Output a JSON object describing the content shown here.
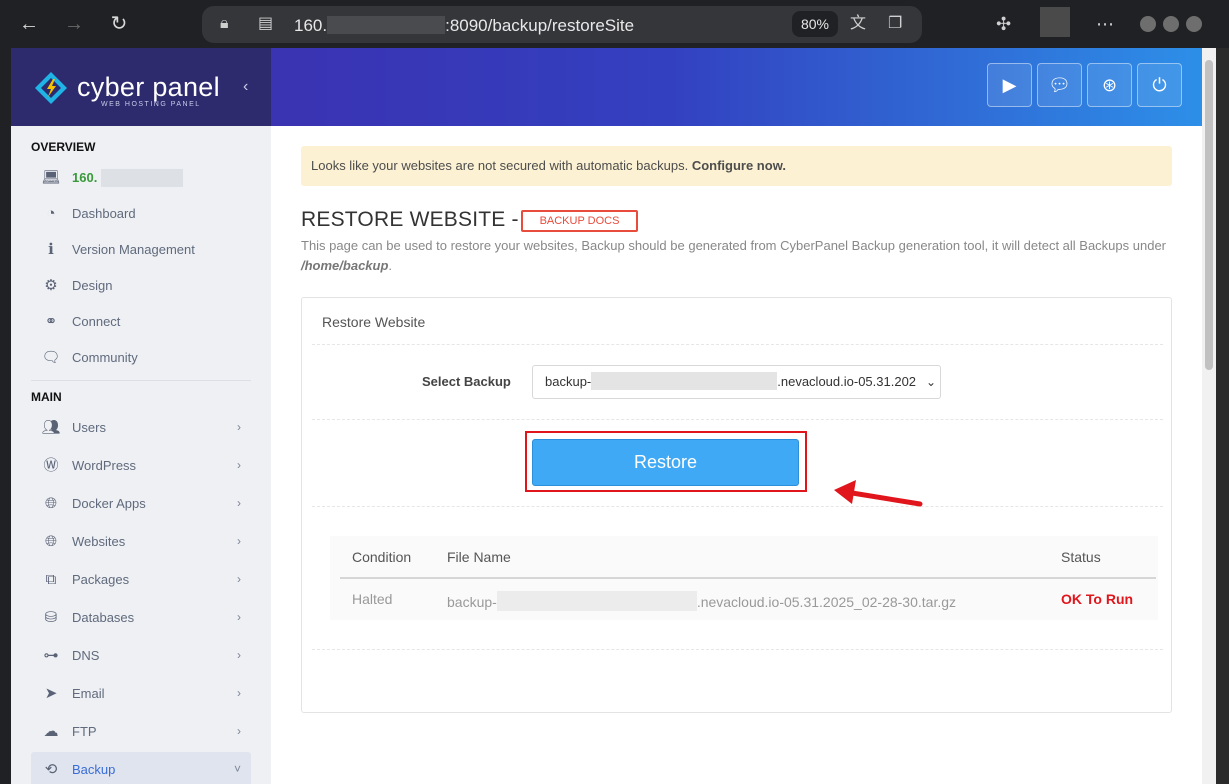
{
  "browser": {
    "url_prefix": "160.",
    "url_suffix": ":8090/backup/restoreSite",
    "zoom": "80%"
  },
  "brand": {
    "name": "cyber panel",
    "subtitle": "WEB HOSTING PANEL"
  },
  "topbar": {
    "buttons": [
      "youtube-icon",
      "chat-icon",
      "support-icon",
      "power-icon"
    ]
  },
  "sidebar": {
    "overview_heading": "OVERVIEW",
    "server_label": "160.",
    "overview_items": [
      {
        "label": "Dashboard",
        "icon": "dashboard-icon"
      },
      {
        "label": "Version Management",
        "icon": "info-icon"
      },
      {
        "label": "Design",
        "icon": "gear-icon"
      },
      {
        "label": "Connect",
        "icon": "link-icon"
      },
      {
        "label": "Community",
        "icon": "comments-icon"
      }
    ],
    "main_heading": "MAIN",
    "main_items": [
      {
        "label": "Users",
        "icon": "users-icon"
      },
      {
        "label": "WordPress",
        "icon": "wordpress-icon"
      },
      {
        "label": "Docker Apps",
        "icon": "globe-icon"
      },
      {
        "label": "Websites",
        "icon": "globe-icon"
      },
      {
        "label": "Packages",
        "icon": "cubes-icon"
      },
      {
        "label": "Databases",
        "icon": "database-icon"
      },
      {
        "label": "DNS",
        "icon": "sitemap-icon"
      },
      {
        "label": "Email",
        "icon": "paper-plane-icon"
      },
      {
        "label": "FTP",
        "icon": "cloud-upload-icon"
      },
      {
        "label": "Backup",
        "icon": "backup-icon"
      }
    ]
  },
  "alert": {
    "text": "Looks like your websites are not secured with automatic backups. ",
    "link": "Configure now."
  },
  "page": {
    "title": "RESTORE WEBSITE -",
    "docs_badge": "BACKUP DOCS",
    "description": "This page can be used to restore your websites, Backup should be generated from CyberPanel Backup generation tool, it will detect all Backups under ",
    "description_path": "/home/backup",
    "description_end": "."
  },
  "card": {
    "title": "Restore Website",
    "select_label": "Select Backup",
    "select_prefix": "backup-",
    "select_suffix": ".nevacloud.io-05.31.202",
    "restore_button": "Restore",
    "table": {
      "headers": [
        "Condition",
        "File Name",
        "Status"
      ],
      "rows": [
        {
          "condition": "Halted",
          "file_prefix": "backup-",
          "file_suffix": ".nevacloud.io-05.31.2025_02-28-30.tar.gz",
          "status": "OK To Run"
        }
      ]
    }
  },
  "colors": {
    "accent": "#3fa9f5",
    "highlight": "#e0161c",
    "status_ok": "#e0161c"
  }
}
